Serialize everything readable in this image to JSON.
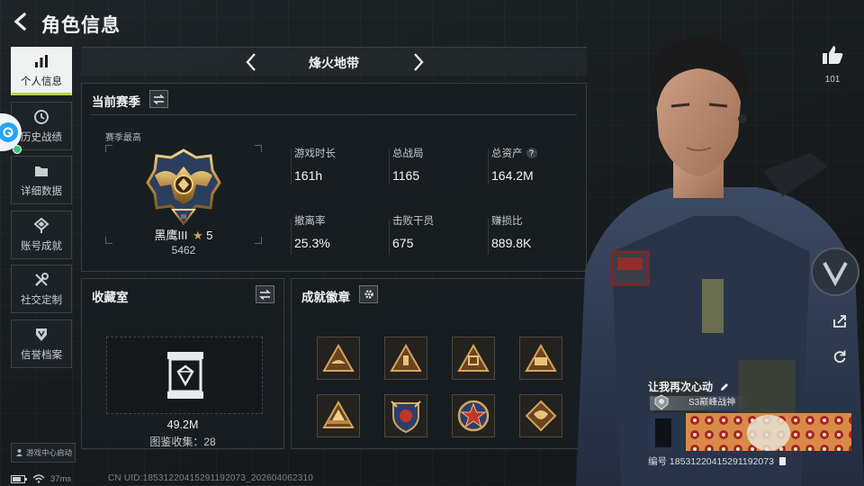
{
  "header": {
    "title": "角色信息"
  },
  "nav": {
    "items": [
      {
        "label": "个人信息",
        "icon": "bar-chart-icon",
        "active": true
      },
      {
        "label": "历史战绩",
        "icon": "clock-icon",
        "active": false
      },
      {
        "label": "详细数据",
        "icon": "folder-icon",
        "active": false
      },
      {
        "label": "账号成就",
        "icon": "medal-icon",
        "active": false
      },
      {
        "label": "社交定制",
        "icon": "tools-icon",
        "active": false
      },
      {
        "label": "信誉档案",
        "icon": "shield-icon",
        "active": false
      }
    ],
    "game_center": "游戏中心启动"
  },
  "mode": {
    "name": "烽火地带"
  },
  "season": {
    "title": "当前赛季",
    "subtitle": "赛季最高",
    "rank_name": "黑鹰III",
    "rank_stars": "5",
    "rank_score": "5462",
    "stats": [
      {
        "label": "游戏时长",
        "value": "161h"
      },
      {
        "label": "总战局",
        "value": "1165"
      },
      {
        "label": "总资产",
        "value": "164.2M",
        "help": "?"
      },
      {
        "label": "撤离率",
        "value": "25.3%"
      },
      {
        "label": "击败干员",
        "value": "675"
      },
      {
        "label": "赚损比",
        "value": "889.8K"
      }
    ]
  },
  "collection": {
    "title": "收藏室",
    "value": "49.2M",
    "count_label": "图鉴收集：28"
  },
  "badges": {
    "title": "成就徽章",
    "items": [
      "badge-1",
      "badge-2",
      "badge-3",
      "badge-4",
      "badge-5",
      "badge-6",
      "badge-7",
      "badge-8"
    ]
  },
  "profile": {
    "likes": "101",
    "player_name": "让我再次心动",
    "title_tag": "S3巅峰战神",
    "id_label": "编号",
    "id_value": "18531220415291192073"
  },
  "status": {
    "ping": "37ms",
    "uid": "CN UID:18531220415291192073_202604062310"
  },
  "colors": {
    "accent": "#b7d43a",
    "gold": "#c9a45a",
    "panel": "#181e21"
  }
}
